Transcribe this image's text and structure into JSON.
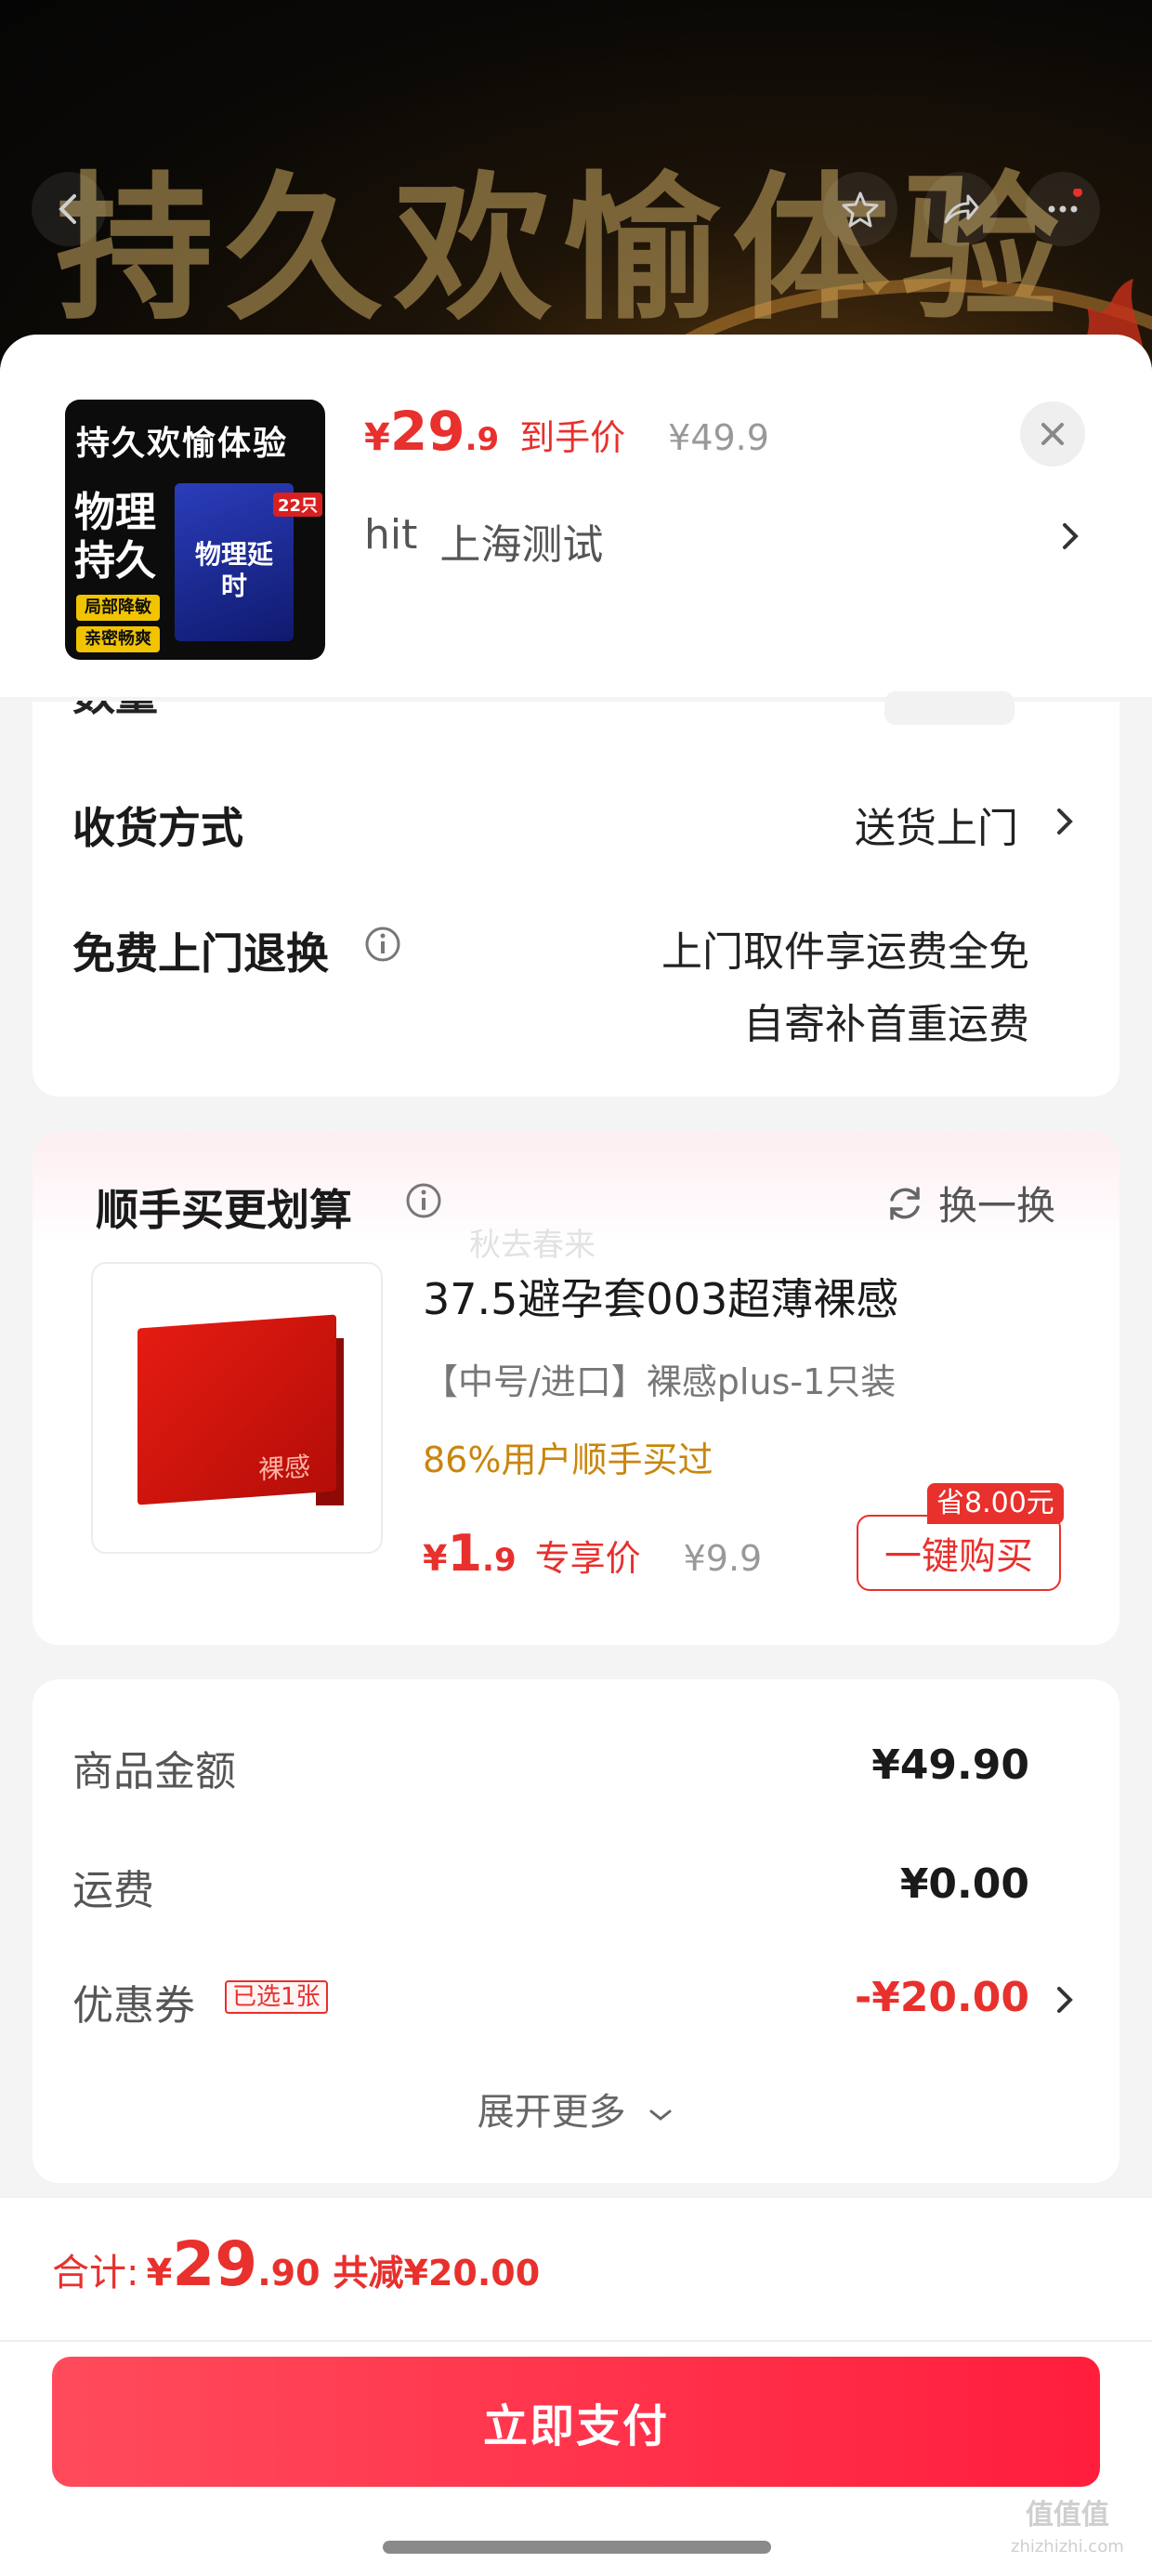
{
  "banner": {
    "title": "持久欢愉体验"
  },
  "product": {
    "thumb": {
      "title": "持久欢愉体验",
      "big": "物理持久",
      "tag1": "局部降敏",
      "tag2": "亲密畅爽",
      "box_text": "物理延时",
      "count": "22只"
    },
    "price": {
      "currency": "¥",
      "int": "29",
      "dec": ".9",
      "tag": "到手价",
      "original": "¥49.9"
    },
    "spec": {
      "a": "hit",
      "b": "上海测试"
    }
  },
  "quantity": {
    "label": "数量"
  },
  "delivery": {
    "label": "收货方式",
    "value": "送货上门"
  },
  "returns": {
    "label": "免费上门退换",
    "line1": "上门取件享运费全免",
    "line2": "自寄补首重运费"
  },
  "bundle": {
    "title": "顺手买更划算",
    "swap_label": "换一换",
    "watermark": "秋去春来",
    "box_text": "裸感",
    "name": "37.5避孕套003超薄裸感",
    "spec": "【中号/进口】裸感plus-1只装",
    "social": "86%用户顺手买过",
    "price": {
      "currency": "¥",
      "int": "1",
      "dec": ".9",
      "tag": "专享价",
      "original": "¥9.9"
    },
    "save_badge": "省8.00元",
    "buy_label": "一键购买"
  },
  "amounts": {
    "goods_label": "商品金额",
    "goods_value": "¥49.90",
    "shipping_label": "运费",
    "shipping_value": "¥0.00",
    "coupon_label": "优惠券",
    "coupon_badge": "已选1张",
    "coupon_value": "-¥20.00",
    "expand_label": "展开更多"
  },
  "footer": {
    "total_label": "合计:",
    "currency": "¥",
    "int": "29",
    "dec": ".90",
    "saved": "共减¥20.00",
    "pay_label": "立即支付"
  },
  "watermark_site": {
    "big": "值值值",
    "small": "zhizhizhi.com"
  },
  "colors": {
    "accent": "#e8302d",
    "pay_gradient_start": "#ff4b5c",
    "pay_gradient_end": "#ff1e3c",
    "social_proof": "#c8860d"
  }
}
